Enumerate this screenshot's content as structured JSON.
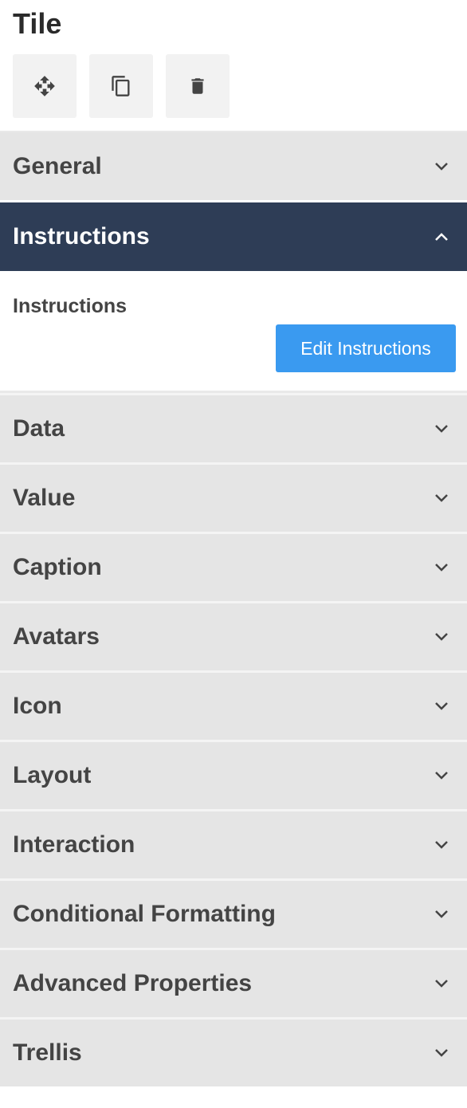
{
  "panel": {
    "title": "Tile"
  },
  "toolbar": {
    "move_icon": "move-icon",
    "duplicate_icon": "duplicate-icon",
    "delete_icon": "trash-icon"
  },
  "sections": {
    "general": {
      "label": "General"
    },
    "instructions": {
      "label": "Instructions",
      "body_label": "Instructions",
      "button_label": "Edit Instructions"
    },
    "data": {
      "label": "Data"
    },
    "value": {
      "label": "Value"
    },
    "caption": {
      "label": "Caption"
    },
    "avatars": {
      "label": "Avatars"
    },
    "icon": {
      "label": "Icon"
    },
    "layout": {
      "label": "Layout"
    },
    "interaction": {
      "label": "Interaction"
    },
    "conditional_formatting": {
      "label": "Conditional Formatting"
    },
    "advanced_properties": {
      "label": "Advanced Properties"
    },
    "trellis": {
      "label": "Trellis"
    }
  },
  "colors": {
    "active_header": "#2e3d56",
    "header_bg": "#e5e5e5",
    "button_primary": "#3a9af0"
  }
}
